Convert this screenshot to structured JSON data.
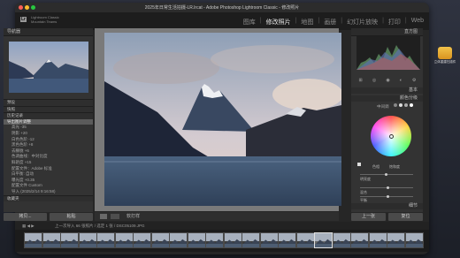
{
  "window": {
    "title": "2025年日常生活拍摄-LR.lrcat - Adobe Photoshop Lightroom Classic - 修改照片"
  },
  "identity": {
    "logo": "Lr",
    "name_line1": "Lightroom Classic",
    "name_line2": "Mountain Teams"
  },
  "modules": [
    "图库",
    "修改照片",
    "地图",
    "画册",
    "幻灯片放映",
    "打印",
    "Web"
  ],
  "active_module": "修改照片",
  "left_panel": {
    "navigator_header": "导航器",
    "sections": [
      {
        "label": "预设",
        "header": true
      },
      {
        "label": "快照",
        "header": true
      },
      {
        "label": "历史记录",
        "header": true
      },
      {
        "label": "导出图片调整",
        "selected": true
      },
      {
        "label": "高光 -35",
        "indent": true
      },
      {
        "label": "阴影 +20",
        "indent": true
      },
      {
        "label": "白色色阶 -12",
        "indent": true
      },
      {
        "label": "黑色色阶 +8",
        "indent": true
      },
      {
        "label": "去朦胧 +6",
        "indent": true
      },
      {
        "label": "色调曲线：中对比度",
        "indent": true
      },
      {
        "label": "鲜艳度 +15",
        "indent": true
      },
      {
        "label": "配置文件：Adobe 标准",
        "indent": true
      },
      {
        "label": "白平衡: 自动",
        "indent": true
      },
      {
        "label": "曝光度 +0.35",
        "indent": true
      },
      {
        "label": "配置文件 Custom",
        "indent": true
      },
      {
        "label": "导入 (2025/2/14 9:16:58)",
        "indent": true
      },
      {
        "label": "收藏夹",
        "header": true
      }
    ],
    "button_copy": "拷贝...",
    "button_paste": "粘贴"
  },
  "right_panel": {
    "histogram_header": "直方图",
    "basic_header": "基本",
    "section_header": "颜色分级",
    "adjust_label": "中间调",
    "tone_curve_header": "色调曲线",
    "values": {
      "hue_label": "色相",
      "sat_label": "饱和度",
      "lum_label": "明亮度",
      "blend_label": "混合",
      "balance_label": "平衡"
    },
    "bottom_header": "细节",
    "button_prev": "上一张",
    "button_reset": "复位"
  },
  "toolbar": {
    "softproof_label": "软打样"
  },
  "filmbar": {
    "info": "上一次导入  66 张照片 / 选定 1 张 / DSC05109.JPG"
  },
  "dock": {
    "label": "立体重建扫描件"
  },
  "colors": {
    "accent": "#e6e6e6",
    "panel": "#333333",
    "background": "#262626"
  },
  "filmstrip_count": 22,
  "filmstrip_selected_index": 16
}
